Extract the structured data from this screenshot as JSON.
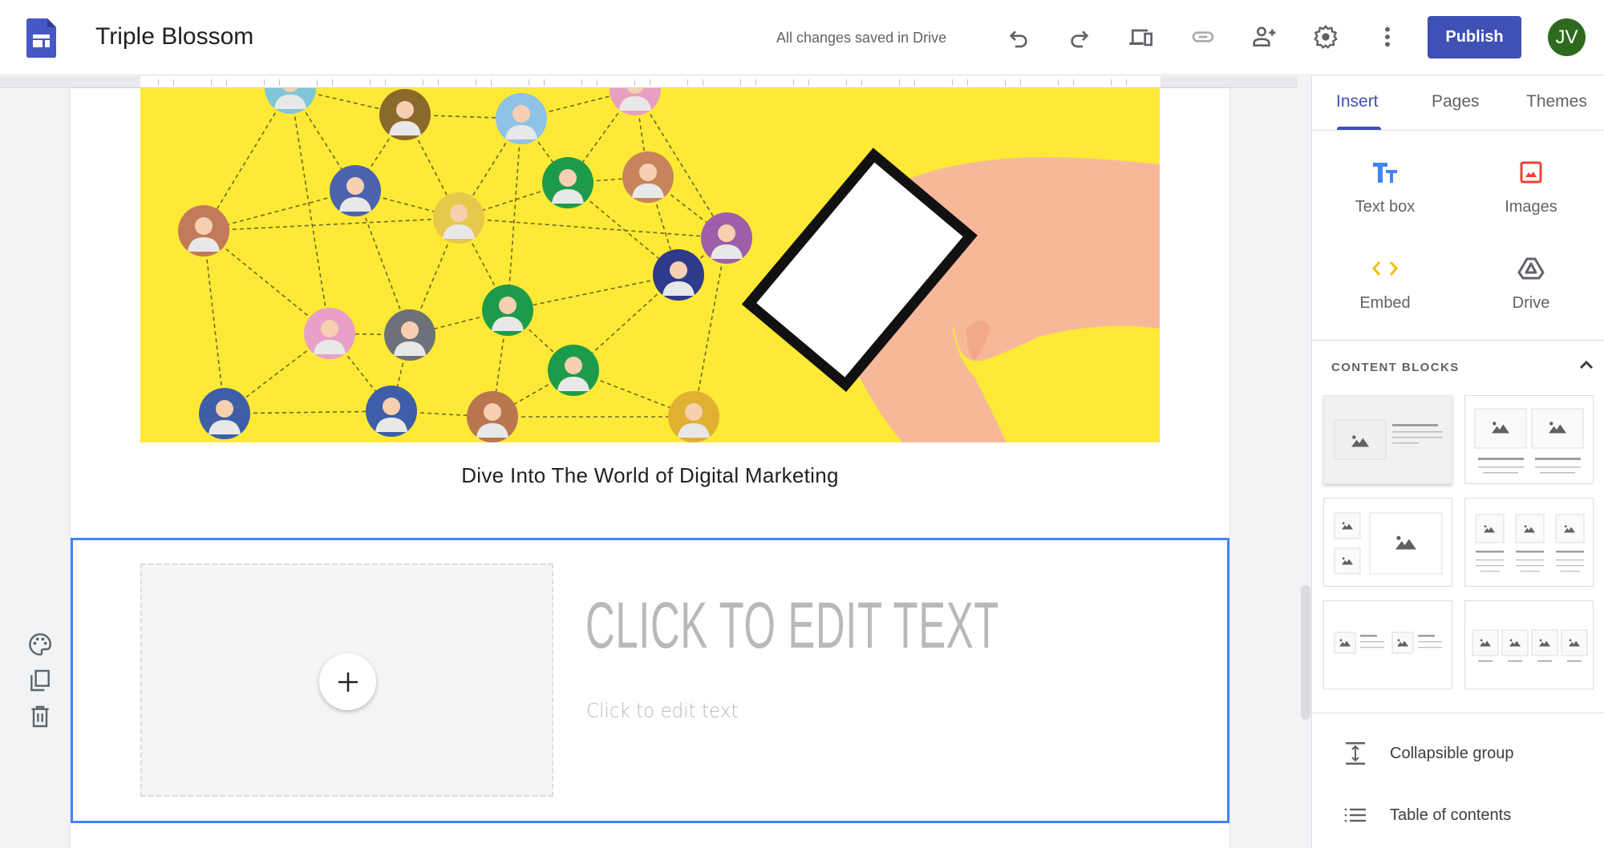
{
  "header": {
    "app_icon": "google-sites-logo",
    "title": "Triple Blossom",
    "save_status": "All changes saved in Drive",
    "toolbar": [
      {
        "name": "undo",
        "icon": "undo-icon"
      },
      {
        "name": "redo",
        "icon": "redo-icon"
      },
      {
        "name": "preview",
        "icon": "devices-icon"
      },
      {
        "name": "copy-link",
        "icon": "link-icon",
        "disabled": true
      },
      {
        "name": "share",
        "icon": "person-add-icon"
      },
      {
        "name": "settings",
        "icon": "gear-icon"
      },
      {
        "name": "more",
        "icon": "more-vert-icon"
      }
    ],
    "publish_label": "Publish",
    "avatar_initials": "JV",
    "avatar_color": "#2e6a1e",
    "accent_color": "#3f51b5"
  },
  "canvas": {
    "hero_image": "digital-marketing-network-illustration",
    "caption": "Dive Into The World of Digital Marketing",
    "selected_section": {
      "heading": "CLICK TO EDIT TEXT",
      "body": "Click to edit text",
      "add_image_icon": "plus-icon",
      "selection_color": "#4285f4"
    },
    "section_tools": [
      {
        "name": "theme-color",
        "icon": "palette-icon"
      },
      {
        "name": "duplicate",
        "icon": "copy-icon"
      },
      {
        "name": "delete",
        "icon": "trash-icon"
      }
    ]
  },
  "panel": {
    "tabs": [
      {
        "label": "Insert",
        "active": true
      },
      {
        "label": "Pages",
        "active": false
      },
      {
        "label": "Themes",
        "active": false
      }
    ],
    "insert_items": [
      {
        "label": "Text box",
        "icon": "text-box-icon",
        "color": "#4285f4"
      },
      {
        "label": "Images",
        "icon": "image-icon",
        "color": "#ea4335"
      },
      {
        "label": "Embed",
        "icon": "embed-code-icon",
        "color": "#fbbc04"
      },
      {
        "label": "Drive",
        "icon": "drive-icon",
        "color": "#5f6368"
      }
    ],
    "content_blocks": {
      "title": "CONTENT BLOCKS",
      "collapse_icon": "chevron-up-icon",
      "layouts": [
        "image-left-text-right",
        "two-images-with-text",
        "two-small-one-large-image",
        "three-images-with-text",
        "two-image-text-rows",
        "four-images-with-captions"
      ]
    },
    "extra_items": [
      {
        "label": "Collapsible group",
        "icon": "collapsible-group-icon"
      },
      {
        "label": "Table of contents",
        "icon": "table-of-contents-icon"
      }
    ]
  }
}
